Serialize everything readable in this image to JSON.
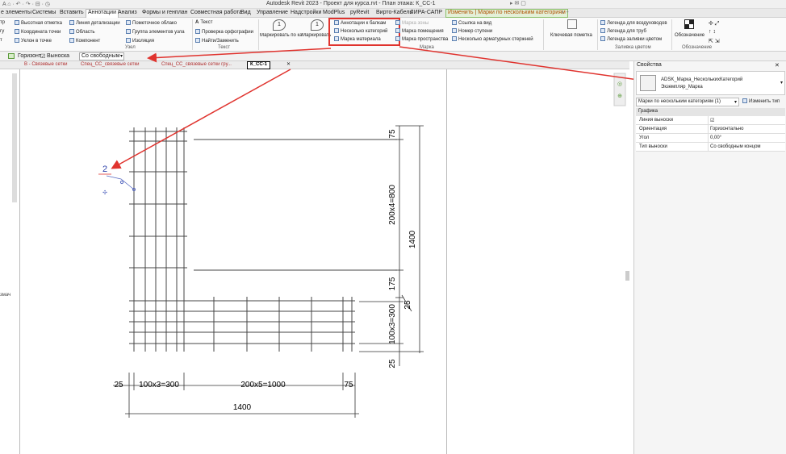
{
  "title": "Autodesk Revit 2023 - Проект для курса.rvt - План этажа: К_СС-1",
  "tabs": [
    "е элементы",
    "Системы",
    "Вставить",
    "Аннотации",
    "Анализ",
    "Формы и генплан",
    "Совместная работа",
    "Вид",
    "Управление",
    "Надстройки",
    "ModPlus",
    "pyRevit",
    "Вирто-Кабель",
    "ЛИРА-САПР",
    "Изменить | Марки по нескольким категориям"
  ],
  "ribbon": {
    "col1": [
      "тр",
      "гу",
      "т"
    ],
    "col2": [
      "Высотная отметка",
      "Координата точки",
      "Уклон в точке"
    ],
    "col3": [
      "Линия детализации",
      "Область",
      "Компонент"
    ],
    "col4": [
      "Пометочное облако",
      "Группа элементов узла",
      "Изоляция"
    ],
    "col5": [
      "Текст",
      "Проверка орфографии",
      "Найти/Заменить"
    ],
    "mark_cat": "Маркировать по категории",
    "mark_all": "Маркировать все",
    "marks_hl": [
      "Аннотации к балкам",
      "Несколько категорий",
      "Марка материала"
    ],
    "marks_2": [
      "Марка зоны",
      "Марка помещения",
      "Марка пространства"
    ],
    "marks_3": [
      "Ссылка на вид",
      "Номер ступени",
      "Несколько арматурных стержней"
    ],
    "key_note": "Ключевая пометка",
    "legends": [
      "Легенда для воздуховодов",
      "Легенда для труб",
      "Легенда заливки цветом"
    ],
    "symbol": "Обозначение",
    "panels": [
      "Узел",
      "Текст",
      "Марка",
      "Заливка цветом",
      "Обозначение"
    ]
  },
  "options": {
    "orientation": "Горизонт",
    "leader_label": "Выноска",
    "leader_type": "Со свободным"
  },
  "doc_tabs": [
    "В - Связевые сетки",
    "Спец_СС_связевые сетки",
    "Спец_СС_связевые сетки гру...",
    "К_СС-1"
  ],
  "left_label": "змач",
  "drawing": {
    "tag": "2",
    "dims_right": [
      "75",
      "200x4=800",
      "1400",
      "175",
      "25",
      "100x3=300",
      "25"
    ],
    "dims_bottom": [
      "25",
      "100x3=300",
      "200x5=1000",
      "75",
      "1400"
    ]
  },
  "properties": {
    "title": "Свойства",
    "type_name": "ADSK_Марка_НесколькихКатегорий",
    "type_sub": "Экземпляр_Марка",
    "selector": "Марки по нескольким категориям (1)",
    "edit_type": "Изменить тип",
    "group": "Графика",
    "rows": [
      {
        "k": "Линия выноски",
        "v": "☑"
      },
      {
        "k": "Ориентация",
        "v": "Горизонтально"
      },
      {
        "k": "Угол",
        "v": "0,00°"
      },
      {
        "k": "Тип выноски",
        "v": "Со свободным концом"
      }
    ]
  }
}
